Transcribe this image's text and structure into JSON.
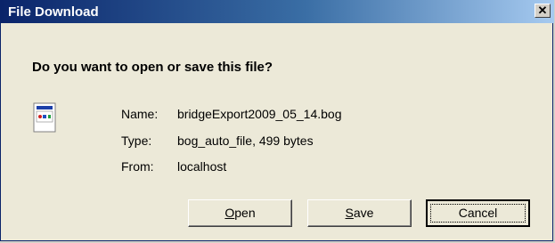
{
  "window": {
    "title": "File Download",
    "close_label": "✕"
  },
  "question": "Do you want to open or save this file?",
  "file": {
    "icon": "file-icon",
    "name_label": "Name:",
    "name": "bridgeExport2009_05_14.bog",
    "type_label": "Type:",
    "type": "bog_auto_file, 499 bytes",
    "from_label": "From:",
    "from": "localhost"
  },
  "buttons": {
    "open": {
      "mnemonic": "O",
      "rest": "pen"
    },
    "save": {
      "mnemonic": "S",
      "rest": "ave"
    },
    "cancel": "Cancel"
  }
}
